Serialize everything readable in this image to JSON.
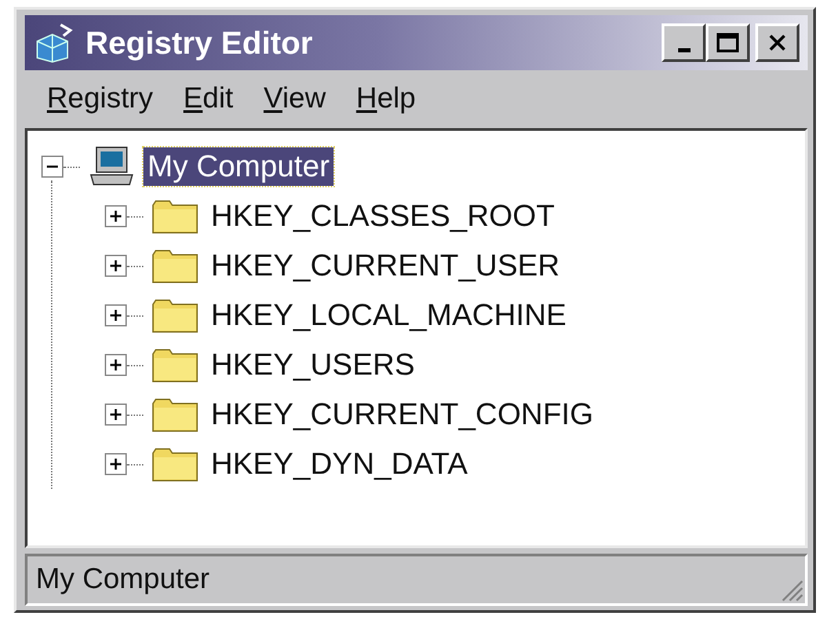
{
  "window": {
    "title": "Registry Editor"
  },
  "menu": [
    {
      "label": "Registry"
    },
    {
      "label": "Edit"
    },
    {
      "label": "View"
    },
    {
      "label": "Help"
    }
  ],
  "tree": [
    {
      "label": "My Computer",
      "expanded": true,
      "selected": true,
      "children": [
        {
          "label": "HKEY_CLASSES_ROOT",
          "expanded": false,
          "selected": false
        },
        {
          "label": "HKEY_CURRENT_USER",
          "expanded": false,
          "selected": false
        },
        {
          "label": "HKEY_LOCAL_MACHINE",
          "expanded": false,
          "selected": false
        },
        {
          "label": "HKEY_USERS",
          "expanded": false,
          "selected": false
        },
        {
          "label": "HKEY_CURRENT_CONFIG",
          "expanded": false,
          "selected": false
        },
        {
          "label": "HKEY_DYN_DATA",
          "expanded": false,
          "selected": false
        }
      ]
    }
  ],
  "status_bar": "My Computer"
}
